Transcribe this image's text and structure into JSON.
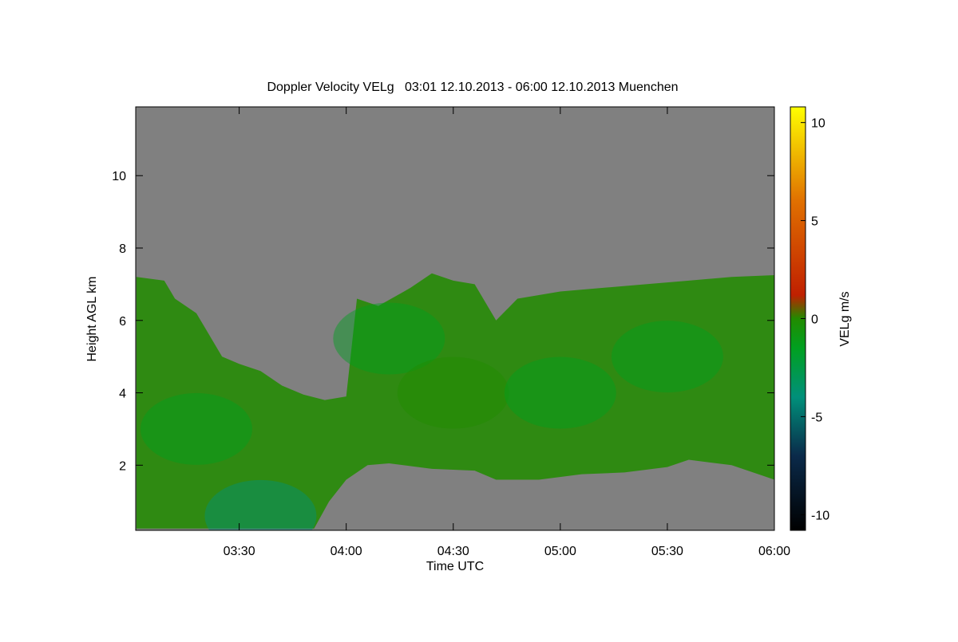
{
  "chart_data": {
    "type": "heatmap",
    "title": "Doppler Velocity VELg   03:01 12.10.2013 - 06:00 12.10.2013 Muenchen",
    "xlabel": "Time UTC",
    "ylabel": "Height AGL km",
    "colorbar_label": "VELg m/s",
    "xlim": [
      3.0167,
      6.0
    ],
    "ylim": [
      0.2,
      11.9
    ],
    "clim": [
      -10.8,
      10.8
    ],
    "x_ticks": [
      {
        "value": 3.5,
        "label": "03:30"
      },
      {
        "value": 4.0,
        "label": "04:00"
      },
      {
        "value": 4.5,
        "label": "04:30"
      },
      {
        "value": 5.0,
        "label": "05:00"
      },
      {
        "value": 5.5,
        "label": "05:30"
      },
      {
        "value": 6.0,
        "label": "06:00"
      }
    ],
    "y_ticks": [
      {
        "value": 2,
        "label": "2"
      },
      {
        "value": 4,
        "label": "4"
      },
      {
        "value": 6,
        "label": "6"
      },
      {
        "value": 8,
        "label": "8"
      },
      {
        "value": 10,
        "label": "10"
      }
    ],
    "colorbar_ticks": [
      {
        "value": 10,
        "label": "10"
      },
      {
        "value": 5,
        "label": "5"
      },
      {
        "value": 0,
        "label": "0"
      },
      {
        "value": -5,
        "label": "-5"
      },
      {
        "value": -10,
        "label": "-10"
      }
    ],
    "colorscale": [
      {
        "value": -10.8,
        "color": "#000000"
      },
      {
        "value": -7,
        "color": "#0a2a4a"
      },
      {
        "value": -4,
        "color": "#00907a"
      },
      {
        "value": -1.5,
        "color": "#00a020"
      },
      {
        "value": 0,
        "color": "#228b00"
      },
      {
        "value": 1.2,
        "color": "#c02000"
      },
      {
        "value": 6,
        "color": "#e07000"
      },
      {
        "value": 10.8,
        "color": "#ffff00"
      }
    ],
    "no_data_color": "#808080",
    "cloud_top_km": [
      [
        3.02,
        7.2
      ],
      [
        3.15,
        7.1
      ],
      [
        3.2,
        6.6
      ],
      [
        3.3,
        6.2
      ],
      [
        3.42,
        5.0
      ],
      [
        3.5,
        4.8
      ],
      [
        3.6,
        4.6
      ],
      [
        3.7,
        4.2
      ],
      [
        3.8,
        3.95
      ],
      [
        3.9,
        3.8
      ],
      [
        4.0,
        3.9
      ],
      [
        4.05,
        6.6
      ],
      [
        4.15,
        6.4
      ],
      [
        4.3,
        6.9
      ],
      [
        4.4,
        7.3
      ],
      [
        4.5,
        7.1
      ],
      [
        4.6,
        7.0
      ],
      [
        4.7,
        6.0
      ],
      [
        4.8,
        6.6
      ],
      [
        5.0,
        6.8
      ],
      [
        5.2,
        6.9
      ],
      [
        5.4,
        7.0
      ],
      [
        5.6,
        7.1
      ],
      [
        5.8,
        7.2
      ],
      [
        6.0,
        7.25
      ]
    ],
    "cloud_base_km": [
      [
        3.02,
        0.25
      ],
      [
        3.3,
        0.25
      ],
      [
        3.5,
        0.25
      ],
      [
        3.6,
        0.25
      ],
      [
        3.85,
        0.25
      ],
      [
        3.92,
        1.0
      ],
      [
        4.0,
        1.6
      ],
      [
        4.1,
        2.0
      ],
      [
        4.2,
        2.05
      ],
      [
        4.4,
        1.9
      ],
      [
        4.6,
        1.85
      ],
      [
        4.7,
        1.6
      ],
      [
        4.9,
        1.6
      ],
      [
        5.1,
        1.75
      ],
      [
        5.3,
        1.8
      ],
      [
        5.5,
        1.95
      ],
      [
        5.6,
        2.15
      ],
      [
        5.8,
        2.0
      ],
      [
        5.95,
        1.7
      ],
      [
        6.0,
        1.6
      ]
    ],
    "mean_velocity_ms": [
      {
        "x": 3.3,
        "y": 3.0,
        "value": -2.5
      },
      {
        "x": 3.6,
        "y": 0.6,
        "value": -4.0
      },
      {
        "x": 4.2,
        "y": 5.5,
        "value": -1.0
      },
      {
        "x": 4.5,
        "y": 4.0,
        "value": -0.5
      },
      {
        "x": 5.0,
        "y": 4.0,
        "value": -1.5
      },
      {
        "x": 5.5,
        "y": 5.0,
        "value": -1.5
      }
    ]
  }
}
